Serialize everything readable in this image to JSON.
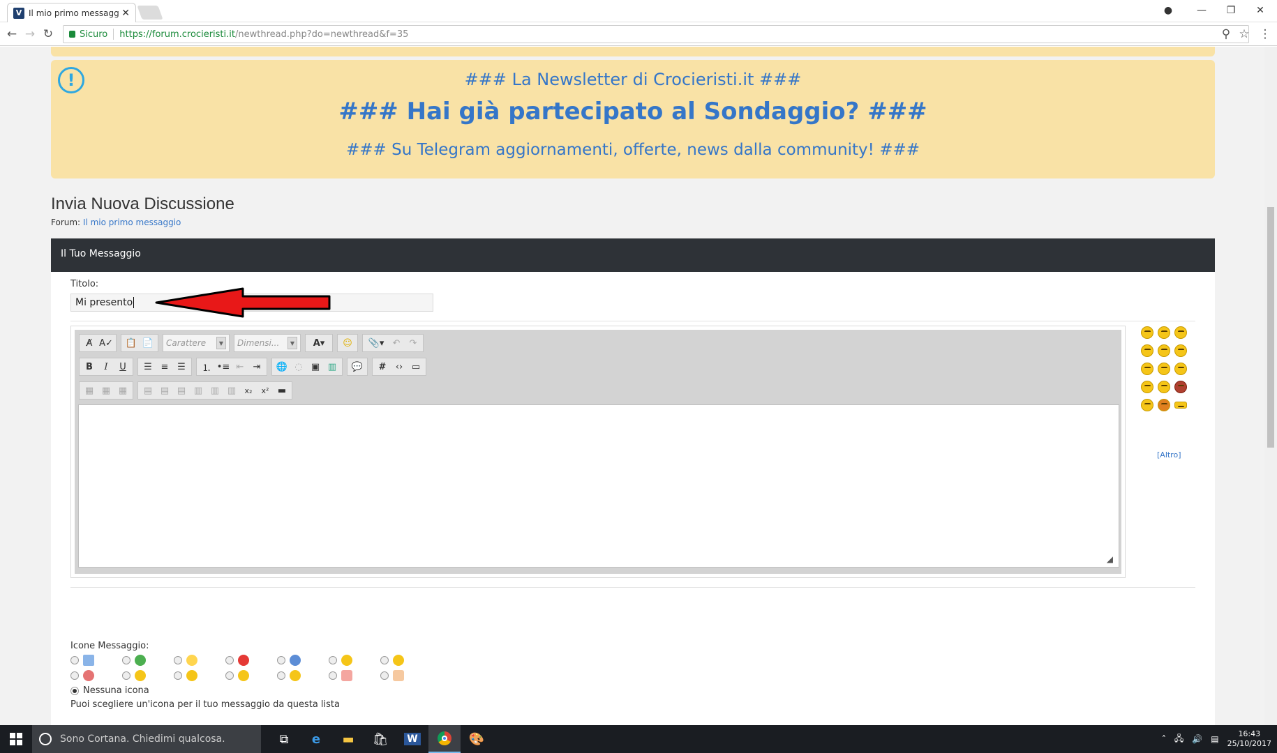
{
  "browser": {
    "tab_title": "Il mio primo messaggio",
    "secure_label": "Sicuro",
    "url_scheme_host": "https://forum.crocieristi.it",
    "url_path": "/newthread.php",
    "url_query": "?do=newthread&f=35"
  },
  "notice": {
    "line1": "### La Newsletter di Crocieristi.it ###",
    "line2": "### Hai già partecipato al Sondaggio? ###",
    "line3": "### Su Telegram aggiornamenti, offerte, news dalla community! ###",
    "accent": "#2ea7e0",
    "bg": "#f9e2a6"
  },
  "page": {
    "title": "Invia Nuova Discussione",
    "breadcrumb_prefix": "Forum:",
    "breadcrumb_link": "Il mio primo messaggio"
  },
  "panel": {
    "header": "Il Tuo Messaggio",
    "title_label": "Titolo:",
    "title_value": "Mi presento",
    "font_placeholder": "Carattere",
    "size_placeholder": "Dimensi...",
    "more_smilies": "[Altro]",
    "icons_label": "Icone Messaggio:",
    "no_icon_label": "Nessuna icona",
    "icons_hint": "Puoi scegliere un'icona per il tuo messaggio da questa lista"
  },
  "taskbar": {
    "search_placeholder": "Sono Cortana. Chiedimi qualcosa.",
    "time": "16:43",
    "date": "25/10/2017"
  },
  "icons": [
    "start-icon",
    "cortana-icon",
    "task-view-icon",
    "edge-icon",
    "explorer-icon",
    "store-icon",
    "word-icon",
    "chrome-icon",
    "paint-icon"
  ]
}
